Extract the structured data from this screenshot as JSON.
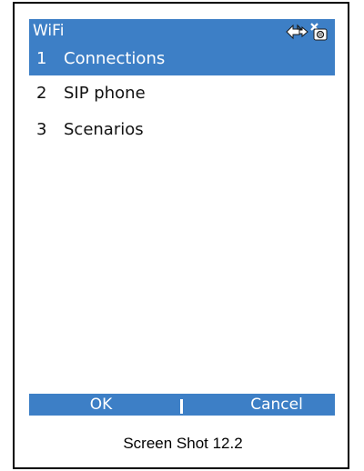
{
  "window": {
    "title": "WiFi"
  },
  "status_icons": [
    "connection-arrows-icon",
    "no-signal-icon"
  ],
  "menu": {
    "items": [
      {
        "number": "1",
        "label": "Connections",
        "selected": true
      },
      {
        "number": "2",
        "label": "SIP phone",
        "selected": false
      },
      {
        "number": "3",
        "label": "Scenarios",
        "selected": false
      }
    ]
  },
  "softkeys": {
    "left_label": "OK",
    "right_label": "Cancel"
  },
  "caption": "Screen Shot 12.2",
  "colors": {
    "accent": "#3d7fc6",
    "text": "#111111",
    "border": "#000000"
  }
}
